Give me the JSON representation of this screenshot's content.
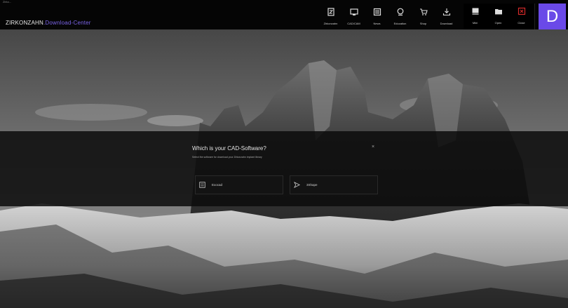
{
  "window": {
    "title": "Zirko..."
  },
  "brand": {
    "part1": "ZIRKONZAHN",
    "part2": ".Download-Center"
  },
  "nav_main": [
    {
      "label": "Zirkonzahn",
      "icon": "zirkonzahn-icon"
    },
    {
      "label": "CAD/CAM",
      "icon": "cad-cam-icon"
    },
    {
      "label": "News",
      "icon": "news-icon"
    },
    {
      "label": "Education",
      "icon": "education-icon"
    },
    {
      "label": "Shop",
      "icon": "cart-icon"
    },
    {
      "label": "Download",
      "icon": "download-icon"
    }
  ],
  "nav_side": [
    {
      "label": "Mini",
      "icon": "minimize-icon"
    },
    {
      "label": "Open",
      "icon": "folder-icon"
    },
    {
      "label": "Close",
      "icon": "close-icon"
    }
  ],
  "d_button": {
    "label": "D"
  },
  "dialog": {
    "title": "Which is your CAD-Software?",
    "subtitle": "Select the software for download your Zirkonzahn implant library",
    "close_glyph": "×",
    "options": [
      {
        "label": "Exocad",
        "icon": "exocad-icon"
      },
      {
        "label": "3Shape",
        "icon": "3shape-icon"
      }
    ]
  },
  "colors": {
    "accent": "#6a49e8",
    "brand_accent": "#7a63e6",
    "close_red": "#d42a2a"
  }
}
